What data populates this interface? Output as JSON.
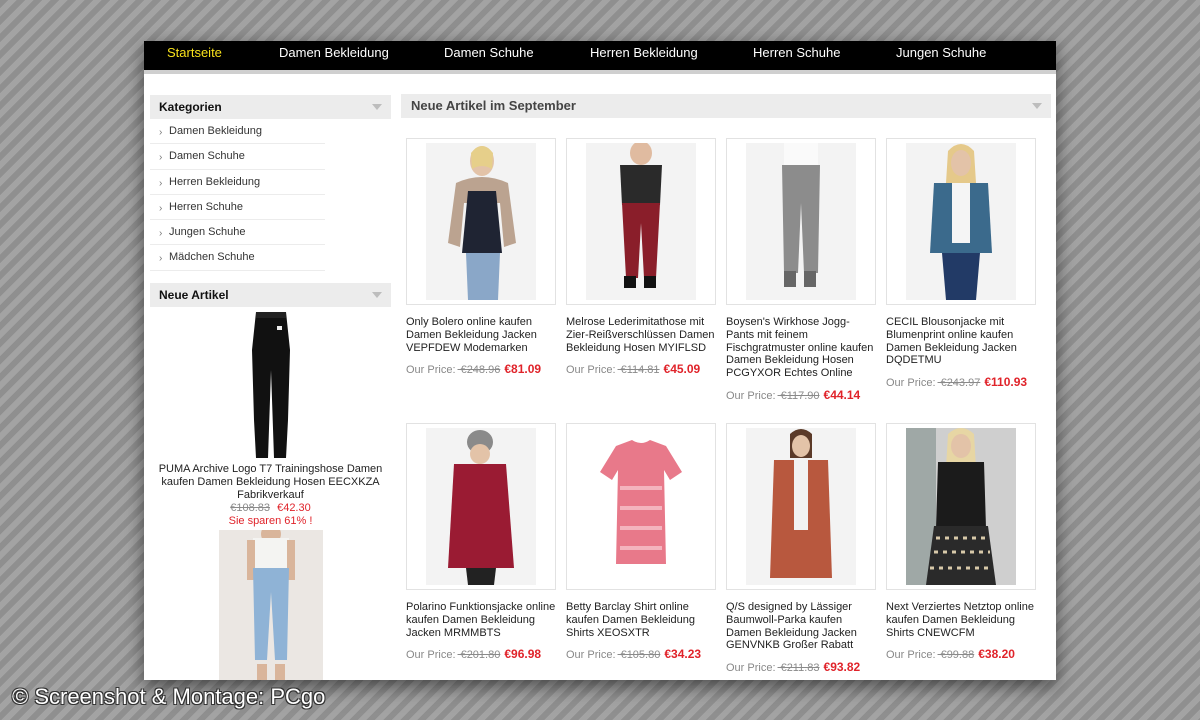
{
  "nav": {
    "items": [
      {
        "label": "Startseite",
        "active": true
      },
      {
        "label": "Damen Bekleidung",
        "active": false
      },
      {
        "label": "Damen Schuhe",
        "active": false
      },
      {
        "label": "Herren Bekleidung",
        "active": false
      },
      {
        "label": "Herren Schuhe",
        "active": false
      },
      {
        "label": "Jungen Schuhe",
        "active": false
      }
    ],
    "active_color": "#f7e11b"
  },
  "sidebar": {
    "categories_title": "Kategorien",
    "categories": [
      "Damen Bekleidung",
      "Damen Schuhe",
      "Herren Bekleidung",
      "Herren Schuhe",
      "Jungen Schuhe",
      "Mädchen Schuhe"
    ],
    "new_title": "Neue Artikel",
    "featured": {
      "name": "PUMA Archive Logo T7 Trainingshose Damen kaufen Damen Bekleidung Hosen EECXKZA Fabrikverkauf",
      "old_price": "€108.83",
      "new_price": "€42.30",
      "savings": "Sie sparen 61% !"
    }
  },
  "main": {
    "title": "Neue Artikel im September",
    "price_label": "Our Price:",
    "products": [
      {
        "name": "Only Bolero online kaufen Damen Bekleidung Jacken VEPFDEW Modemarken",
        "old": "€248.96",
        "now": "€81.09"
      },
      {
        "name": "Melrose Lederimitathose mit Zier-Reißverschlüssen Damen Bekleidung Hosen MYIFLSD",
        "old": "€114.81",
        "now": "€45.09"
      },
      {
        "name": "Boysen's Wirkhose Jogg-Pants mit feinem Fischgratmuster online kaufen Damen Bekleidung Hosen PCGYXOR Echtes Online",
        "old": "€117.90",
        "now": "€44.14"
      },
      {
        "name": "CECIL Blousonjacke mit Blumenprint online kaufen Damen Bekleidung Jacken DQDETMU",
        "old": "€243.97",
        "now": "€110.93"
      },
      {
        "name": "Polarino Funktionsjacke online kaufen Damen Bekleidung Jacken MRMMBTS",
        "old": "€201.80",
        "now": "€96.98"
      },
      {
        "name": "Betty Barclay Shirt online kaufen Damen Bekleidung Shirts XEOSXTR",
        "old": "€105.80",
        "now": "€34.23"
      },
      {
        "name": "Q/S designed by Lässiger Baumwoll-Parka kaufen Damen Bekleidung Jacken GENVNKB Großer Rabatt",
        "old": "€211.83",
        "now": "€93.82"
      },
      {
        "name": "Next Verziertes Netztop online kaufen Damen Bekleidung Shirts CNEWCFM",
        "old": "€99.88",
        "now": "€38.20"
      }
    ]
  },
  "watermark": "© Screenshot & Montage: PCgo",
  "colors": {
    "price_red": "#e0232a",
    "nav_bg": "#000000"
  }
}
